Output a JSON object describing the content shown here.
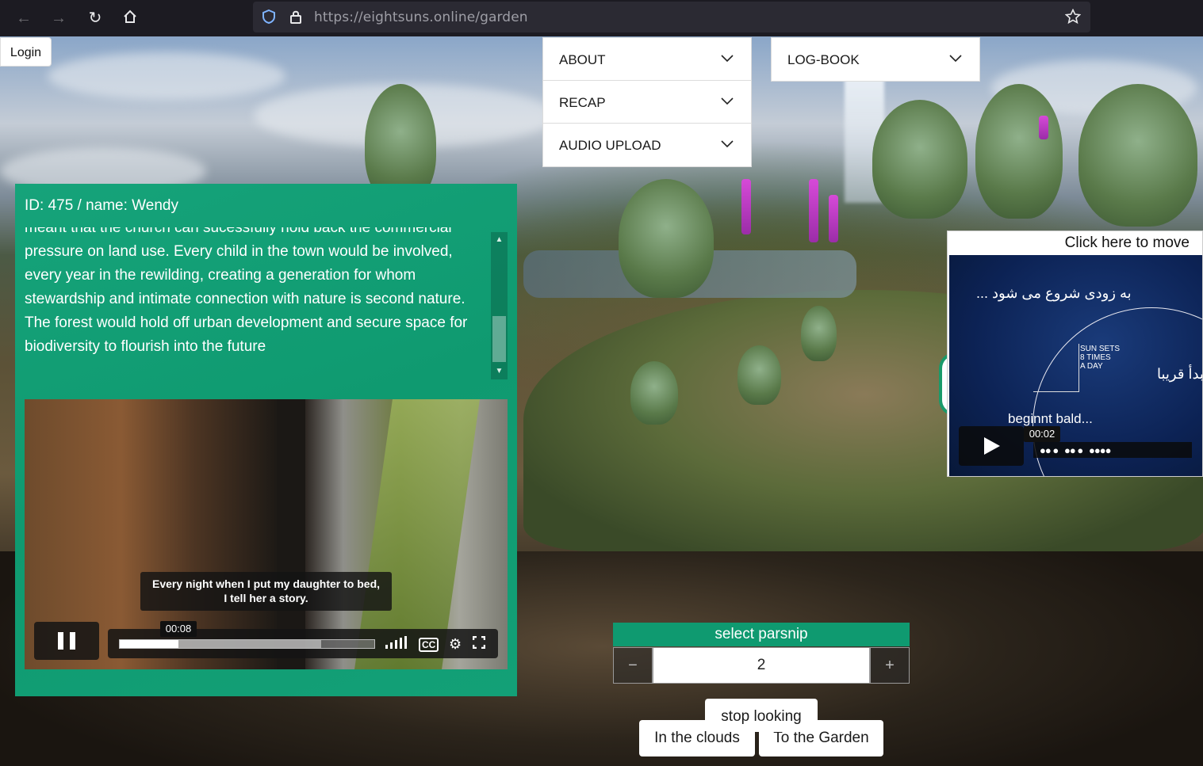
{
  "browser": {
    "url_host": "https://eightsuns.online",
    "url_path": "/garden"
  },
  "login": {
    "label": "Login"
  },
  "menu_left": [
    {
      "label": "ABOUT"
    },
    {
      "label": "RECAP"
    },
    {
      "label": "AUDIO UPLOAD"
    }
  ],
  "menu_right": [
    {
      "label": "LOG-BOOK"
    }
  ],
  "info_panel": {
    "title": "ID: 475 / name: Wendy",
    "text": "meant that the church can sucessfully hold back the commercial pressure on land use. Every child in the town would be involved, every year in the rewilding, creating a generation for whom stewardship and intimate connection with nature is second nature. The forest would hold off urban development and secure space for biodiversity to flourish into the future",
    "video": {
      "caption_line1": "Every night when I put my daughter to bed,",
      "caption_line2": "I tell her a story.",
      "time": "00:08",
      "played_fraction": 0.23,
      "buffered_fraction": 0.79,
      "cc_label": "CC"
    }
  },
  "float_panel": {
    "header": "Click here to move",
    "persian_text": "به زودی شروع می شود ...",
    "sun_sets_1": "SUN SETS",
    "sun_sets_2": "8 TIMES",
    "sun_sets_3": "A DAY",
    "arabic_text": "يبدأ قريبا",
    "german_text": "beginnt bald...",
    "time": "00:02"
  },
  "parsnip": {
    "title": "select parsnip",
    "minus": "−",
    "plus": "+",
    "value": "2"
  },
  "buttons": {
    "stop_looking": "stop looking",
    "in_the_clouds": "In the clouds",
    "to_the_garden": "To the Garden"
  },
  "colors": {
    "panel_green": "#0f9a70",
    "chrome_bg": "#1c1b22"
  }
}
